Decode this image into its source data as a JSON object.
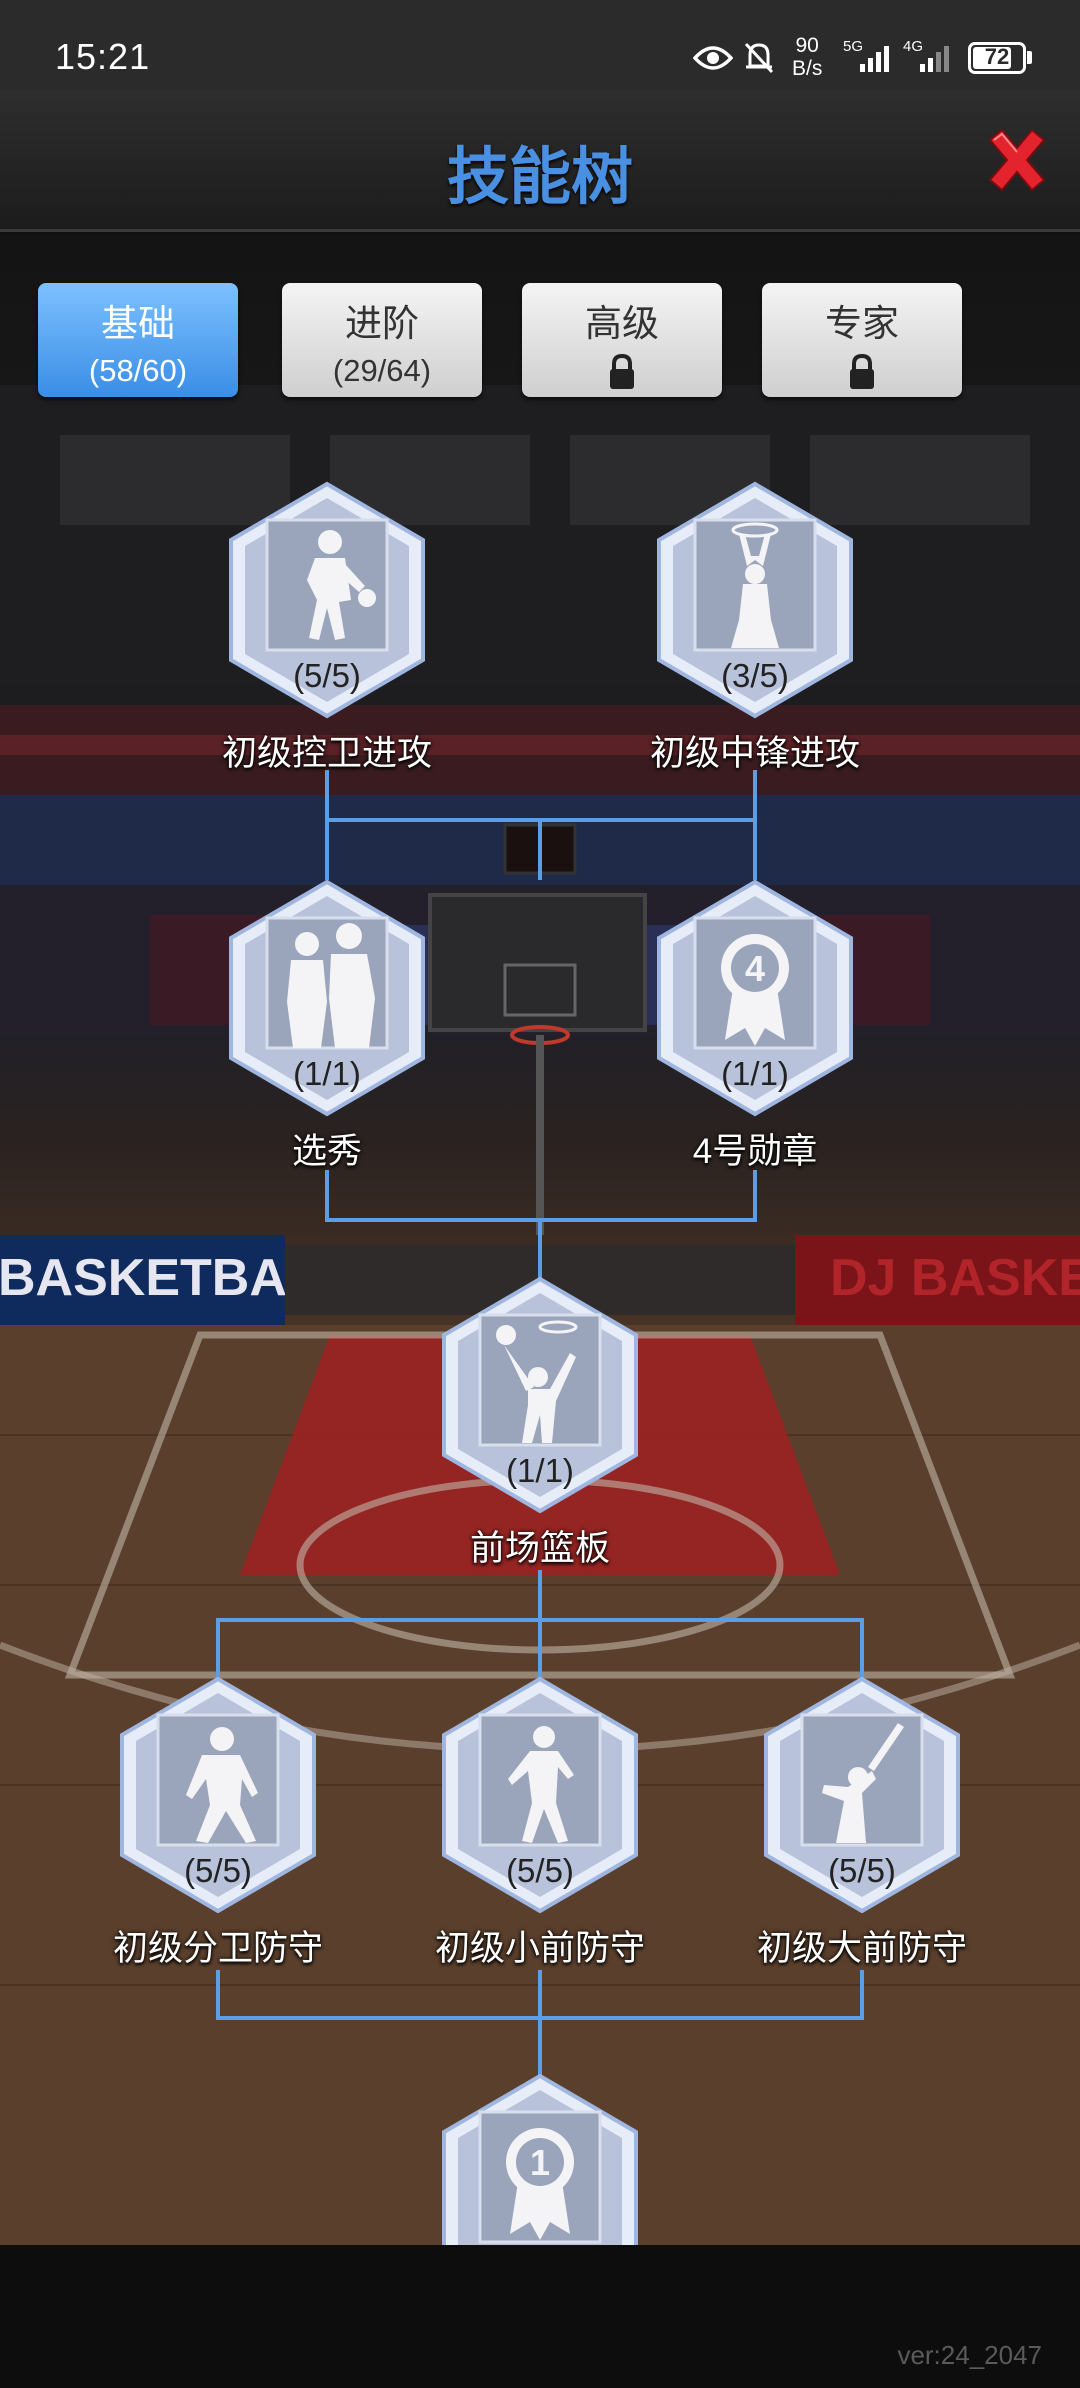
{
  "status_bar": {
    "time": "15:21",
    "net_speed_value": "90",
    "net_speed_unit": "B/s",
    "signal_1": "5G",
    "signal_2": "4G",
    "battery": "72"
  },
  "header": {
    "title": "技能树",
    "close_icon": "close-x-icon",
    "close_color": "#d0202a",
    "title_color": "#4a90e2"
  },
  "tabs": [
    {
      "label": "基础",
      "count": "(58/60)",
      "locked": false,
      "active": true
    },
    {
      "label": "进阶",
      "count": "(29/64)",
      "locked": false,
      "active": false
    },
    {
      "label": "高级",
      "locked": true,
      "active": false
    },
    {
      "label": "专家",
      "locked": true,
      "active": false
    }
  ],
  "skills": [
    {
      "id": "pg-offense",
      "label": "初级控卫进攻",
      "count": "(5/5)",
      "icon": "dribble-player-icon"
    },
    {
      "id": "c-offense",
      "label": "初级中锋进攻",
      "count": "(3/5)",
      "icon": "dunk-player-icon"
    },
    {
      "id": "draft",
      "label": "选秀",
      "count": "(1/1)",
      "icon": "handshake-icon"
    },
    {
      "id": "medal-4",
      "label": "4号勋章",
      "count": "(1/1)",
      "icon": "medal-4-icon",
      "badge": "4"
    },
    {
      "id": "frontcourt-rebound",
      "label": "前场篮板",
      "count": "(1/1)",
      "icon": "rebound-player-icon"
    },
    {
      "id": "sg-defense",
      "label": "初级分卫防守",
      "count": "(5/5)",
      "icon": "defense-stance-icon"
    },
    {
      "id": "sf-defense",
      "label": "初级小前防守",
      "count": "(5/5)",
      "icon": "defense-player-icon"
    },
    {
      "id": "pf-defense",
      "label": "初级大前防守",
      "count": "(5/5)",
      "icon": "block-player-icon"
    },
    {
      "id": "medal-1",
      "badge": "1",
      "icon": "medal-1-icon"
    }
  ],
  "court_banner_left": "BASKETBALL",
  "court_banner_right": "DJ BASKETB",
  "version": "ver:24_2047"
}
